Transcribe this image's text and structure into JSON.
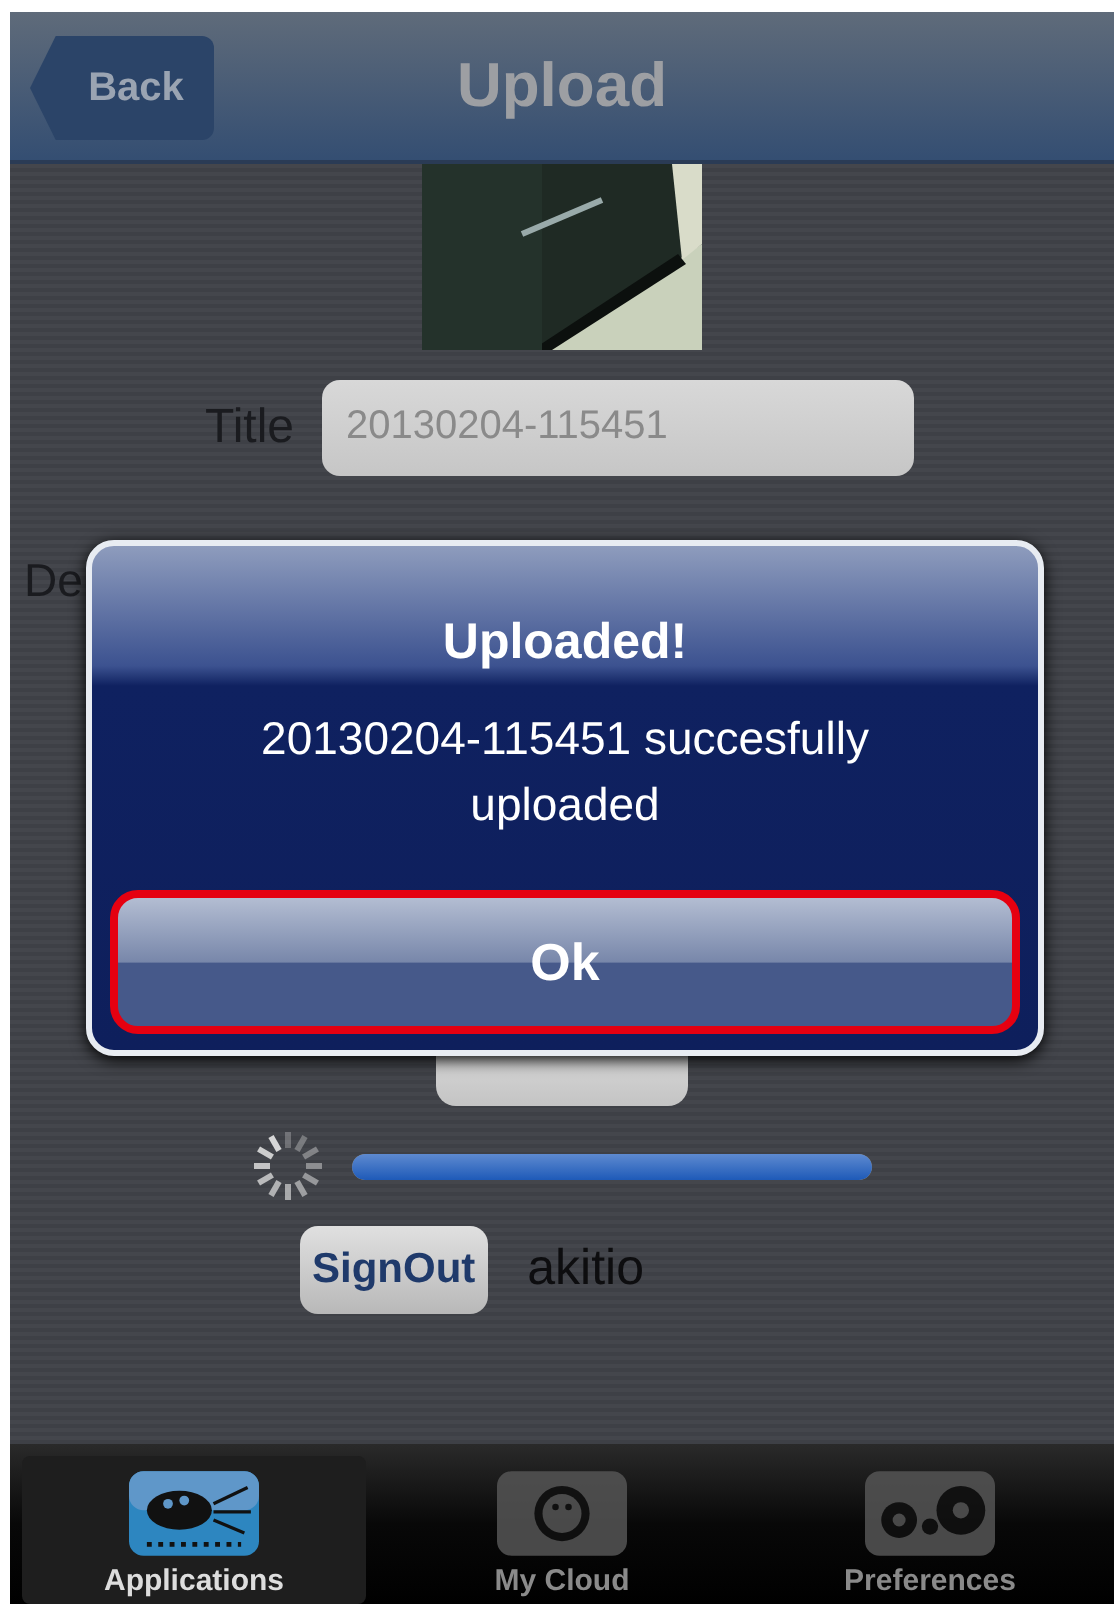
{
  "nav_bar": {
    "back_button": "Back",
    "title": "Upload"
  },
  "form": {
    "fields": [
      {
        "label": "Title",
        "value": "20130204-115451"
      },
      {
        "label": "De"
      }
    ],
    "progress": {
      "level": 1.0
    },
    "signout_button": "SignOut",
    "username": "akitio"
  },
  "alert": {
    "title": "Uploaded!",
    "message": "20130204-115451 succesfully uploaded",
    "button": "Ok",
    "highlighted": true
  },
  "tab_bar": [
    {
      "label": "Applications",
      "selected": true
    },
    {
      "label": "My Cloud",
      "selected": false
    },
    {
      "label": "Preferences",
      "selected": false
    }
  ]
}
